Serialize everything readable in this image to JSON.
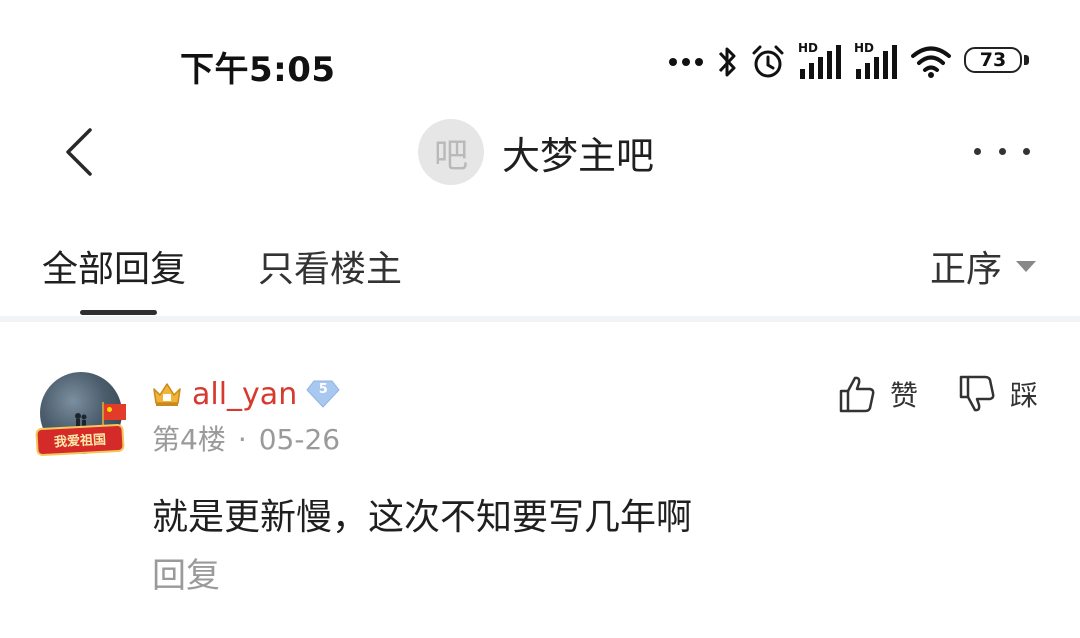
{
  "status_bar": {
    "time": "下午5:05",
    "icons": [
      "more-dots-icon",
      "bluetooth-icon",
      "alarm-icon",
      "hd-signal-icon",
      "hd-signal-icon",
      "wifi-icon",
      "battery-icon"
    ],
    "hd_label_1": "HD",
    "hd_label_2": "HD",
    "battery_level": "73"
  },
  "header": {
    "forum_avatar_char": "吧",
    "forum_name": "大梦主吧"
  },
  "tabs": {
    "all_replies": "全部回复",
    "only_op": "只看楼主",
    "sort_label": "正序"
  },
  "post": {
    "username": "all_yan",
    "level": "5",
    "floor": "第4楼",
    "separator": "·",
    "date": "05-26",
    "content": "就是更新慢，这次不知要写几年啊",
    "reply_label": "回复",
    "like_label": "赞",
    "dislike_label": "踩",
    "pendant_text": "我爱祖国"
  },
  "colors": {
    "username": "#d63a2f",
    "muted_text": "#9a9a9a",
    "level_badge": "#a9c8f0",
    "divider": "#f1f4f7"
  }
}
